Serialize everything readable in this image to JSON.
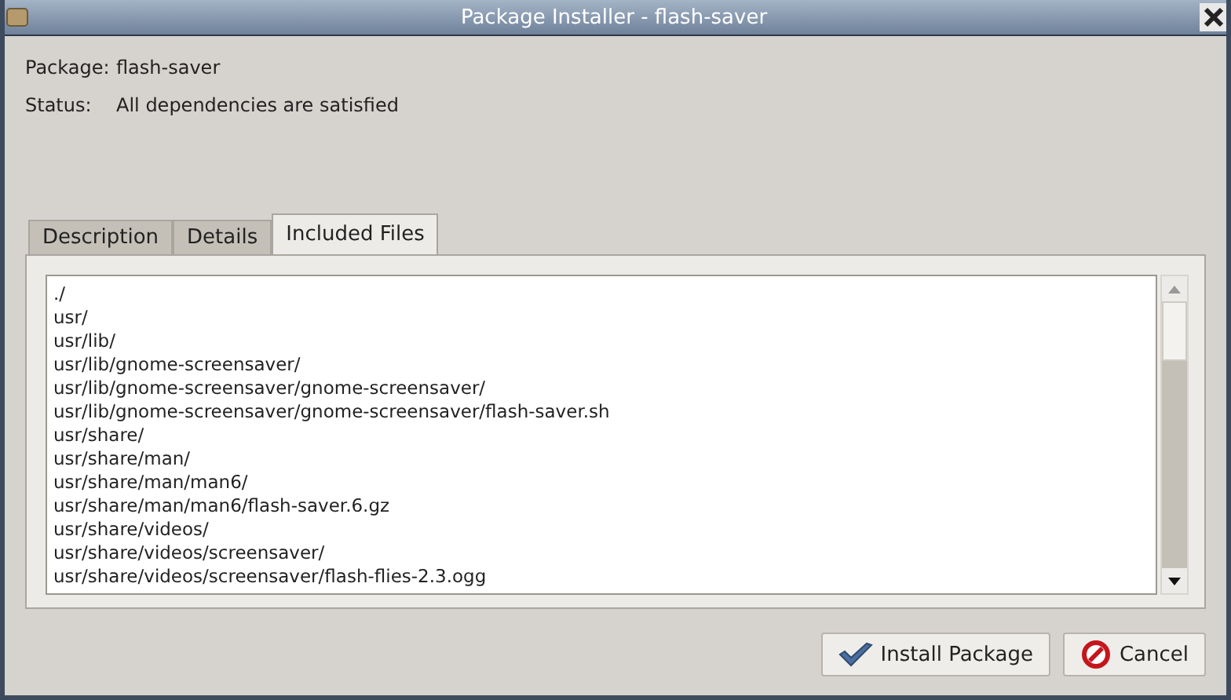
{
  "window": {
    "title": "Package Installer - flash-saver"
  },
  "info": [
    {
      "label": "Package:",
      "value": "flash-saver"
    },
    {
      "label": "Status:",
      "value": "All dependencies are satisfied"
    }
  ],
  "tabs": [
    {
      "label": "Description",
      "selected": false
    },
    {
      "label": "Details",
      "selected": false
    },
    {
      "label": "Included Files",
      "selected": true
    }
  ],
  "files": [
    "./",
    "usr/",
    "usr/lib/",
    "usr/lib/gnome-screensaver/",
    "usr/lib/gnome-screensaver/gnome-screensaver/",
    "usr/lib/gnome-screensaver/gnome-screensaver/flash-saver.sh",
    "usr/share/",
    "usr/share/man/",
    "usr/share/man/man6/",
    "usr/share/man/man6/flash-saver.6.gz",
    "usr/share/videos/",
    "usr/share/videos/screensaver/",
    "usr/share/videos/screensaver/flash-flies-2.3.ogg"
  ],
  "buttons": [
    {
      "kind": "install",
      "label": "Install Package"
    },
    {
      "kind": "cancel",
      "label": "Cancel"
    }
  ]
}
